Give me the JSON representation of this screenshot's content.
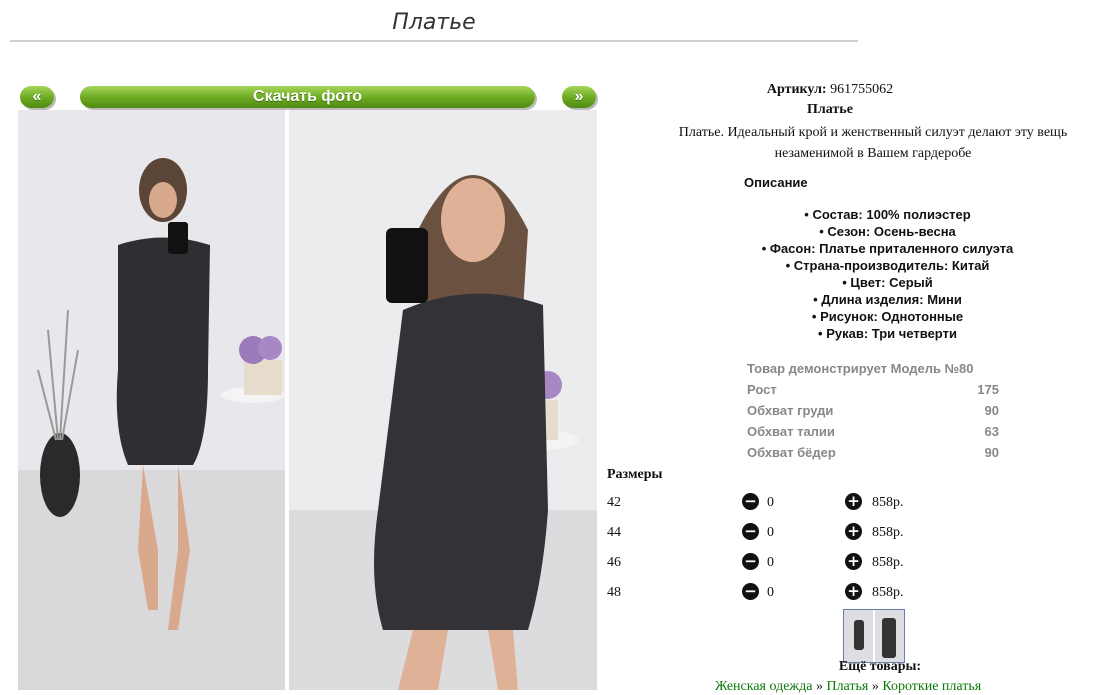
{
  "page": {
    "title": "Платье"
  },
  "gallery": {
    "prev_label": "«",
    "next_label": "»",
    "download_label": "Скачать фото"
  },
  "product": {
    "sku_label": "Артикул:",
    "sku_value": "961755062",
    "name": "Платье",
    "description": "Платье. Идеальный крой и женственный силуэт делают эту вещь незаменимой в Вашем гардеробе",
    "description_heading": "Описание",
    "properties": [
      "Состав: 100% полиэстер",
      "Сезон: Осень-весна",
      "Фасон: Платье приталенного силуэта",
      "Страна-производитель: Китай",
      "Цвет: Серый",
      "Длина изделия: Мини",
      "Рисунок: Однотонные",
      "Рукав: Три четверти"
    ]
  },
  "model": {
    "heading": "Товар демонстрирует Модель №80",
    "rows": [
      {
        "label": "Рост",
        "value": "175"
      },
      {
        "label": "Обхват груди",
        "value": "90"
      },
      {
        "label": "Обхват талии",
        "value": "63"
      },
      {
        "label": "Обхват бёдер",
        "value": "90"
      }
    ]
  },
  "sizes": {
    "heading": "Размеры",
    "items": [
      {
        "size": "42",
        "qty": "0",
        "price": "858р."
      },
      {
        "size": "44",
        "qty": "0",
        "price": "858р."
      },
      {
        "size": "46",
        "qty": "0",
        "price": "858р."
      },
      {
        "size": "48",
        "qty": "0",
        "price": "858р."
      }
    ],
    "minus_symbol": "−",
    "plus_symbol": "+"
  },
  "more": {
    "heading": "Ещё товары:",
    "breadcrumbs": [
      "Женская одежда",
      "Платья",
      "Короткие платья"
    ],
    "separator": "»"
  },
  "colors": {
    "button_green": "#6aa820",
    "link_green": "#0a7a0a",
    "muted_text": "#888888"
  }
}
